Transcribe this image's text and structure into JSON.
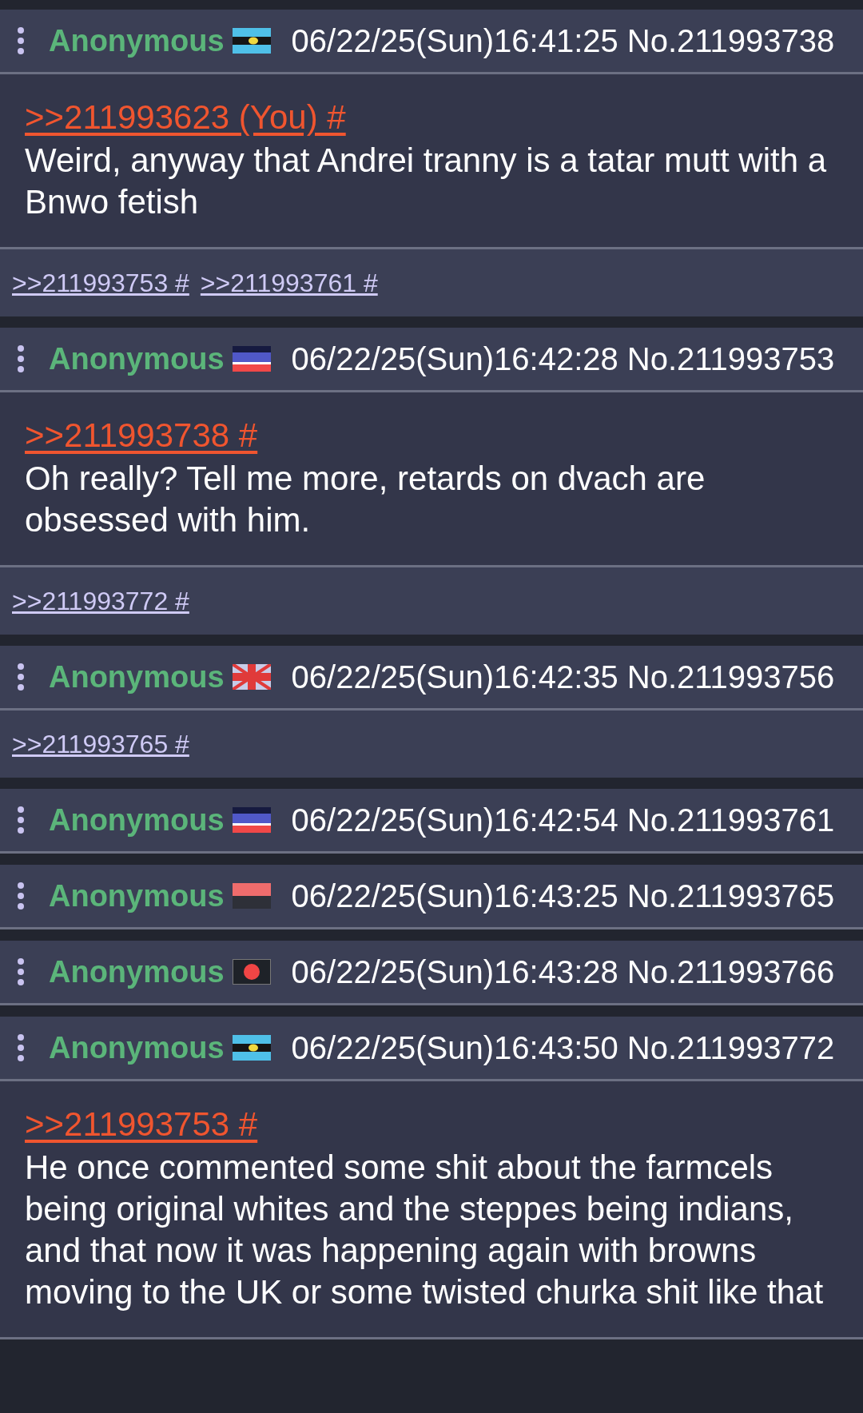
{
  "posts": [
    {
      "name": "Anonymous",
      "kind": "stripe-dot",
      "date": "06/22/25(Sun)16:41:25",
      "number": "No.211993738",
      "quote": ">>211993623 (You) #",
      "text": "Weird, anyway that Andrei tranny is a tatar mutt with a Bnwo fetish",
      "replies": [
        ">>211993753 #",
        ">>211993761 #"
      ]
    },
    {
      "name": "Anonymous",
      "kind": "tricolor",
      "date": "06/22/25(Sun)16:42:28",
      "number": "No.211993753",
      "quote": ">>211993738 #",
      "text": "Oh really? Tell me more, retards on dvach are obsessed with him.",
      "replies": [
        ">>211993772 #"
      ]
    },
    {
      "name": "Anonymous",
      "kind": "cross",
      "date": "06/22/25(Sun)16:42:35",
      "number": "No.211993756",
      "replies": [
        ">>211993765 #"
      ]
    },
    {
      "name": "Anonymous",
      "kind": "tricolor",
      "date": "06/22/25(Sun)16:42:54",
      "number": "No.211993761"
    },
    {
      "name": "Anonymous",
      "kind": "bicolor",
      "date": "06/22/25(Sun)16:43:25",
      "number": "No.211993765"
    },
    {
      "name": "Anonymous",
      "kind": "disc",
      "date": "06/22/25(Sun)16:43:28",
      "number": "No.211993766"
    },
    {
      "name": "Anonymous",
      "kind": "stripe-dot",
      "date": "06/22/25(Sun)16:43:50",
      "number": "No.211993772",
      "quote": ">>211993753 #",
      "text": "He once commented some shit about the farmcels being original whites and the steppes being indians, and that now it was happening again with browns moving to the UK or some twisted churka shit like that"
    }
  ]
}
